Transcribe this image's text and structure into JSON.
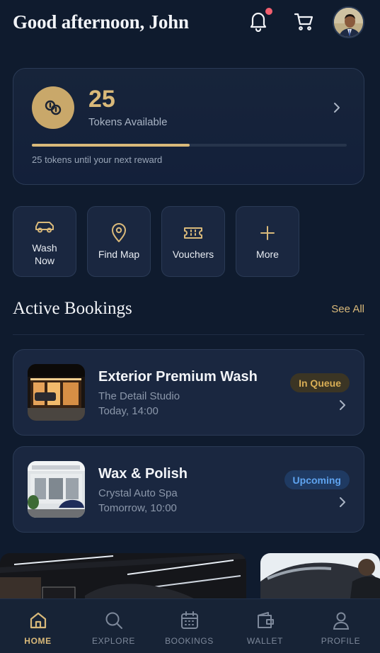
{
  "header": {
    "greeting": "Good afternoon, John",
    "notification_icon": "bell-icon",
    "cart_icon": "cart-icon"
  },
  "tokens": {
    "count": "25",
    "label": "Tokens Available",
    "progress_fraction": 0.5,
    "progress_text": "25 tokens until your next reward"
  },
  "quick_actions": [
    {
      "label": "Wash Now",
      "icon": "car-icon"
    },
    {
      "label": "Find Map",
      "icon": "map-pin-icon"
    },
    {
      "label": "Vouchers",
      "icon": "ticket-icon"
    },
    {
      "label": "More",
      "icon": "plus-icon"
    }
  ],
  "active_bookings": {
    "title": "Active Bookings",
    "see_all": "See All",
    "items": [
      {
        "title": "Exterior Premium Wash",
        "place": "The Detail Studio",
        "time": "Today, 14:00",
        "status": "In Queue"
      },
      {
        "title": "Wax & Polish",
        "place": "Crystal Auto Spa",
        "time": "Tomorrow, 10:00",
        "status": "Upcoming"
      }
    ]
  },
  "nav": {
    "items": [
      {
        "label": "HOME",
        "icon": "home-icon"
      },
      {
        "label": "EXPLORE",
        "icon": "search-icon"
      },
      {
        "label": "BOOKINGS",
        "icon": "calendar-icon"
      },
      {
        "label": "WALLET",
        "icon": "wallet-icon"
      },
      {
        "label": "PROFILE",
        "icon": "user-icon"
      }
    ],
    "active": "HOME"
  },
  "colors": {
    "background": "#0f1b2e",
    "accent_gold": "#d9b97a",
    "queue_badge": "#d9ae55",
    "upcoming_badge": "#5fa4f0"
  }
}
